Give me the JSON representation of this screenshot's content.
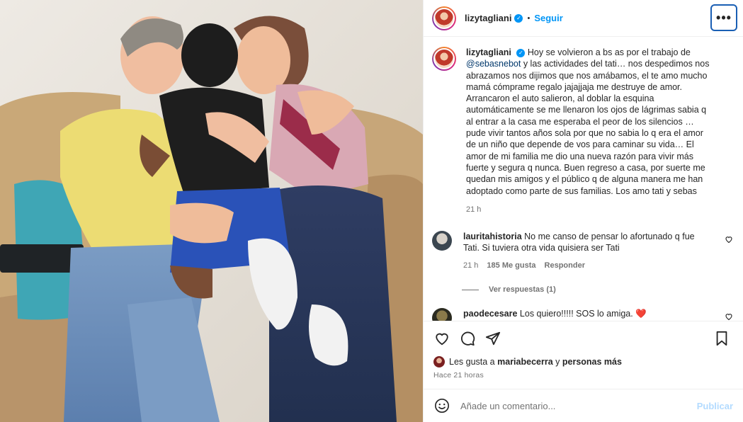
{
  "post": {
    "username": "lizytagliani",
    "follow_label": "Seguir",
    "more_label": "•••",
    "caption_mention": "@sebasnebot",
    "caption_part1": "Hoy se volvieron a bs as por el trabajo de",
    "caption_part2": "y las actividades del tati… nos despedimos nos abrazamos nos dijimos que nos amábamos, el te amo mucho mamá cómprame regalo jajajjaja me destruye de amor. Arrancaron el auto salieron, al doblar la esquina automáticamente se me llenaron los ojos de lágrimas sabia q al entrar a la casa me esperaba el peor de los silencios … pude vivir tantos años sola por que no sabia lo q era el amor de un niño que depende de vos para caminar su vida… El amor de mi familia me dio una nueva razón para vivir más fuerte y segura q nunca. Buen regreso a casa, por suerte me quedan mis amigos y el público q de alguna manera me han adoptado como parte de sus familias. Los amo tati y sebas",
    "caption_time": "21 h"
  },
  "comments": [
    {
      "username": "lauritahistoria",
      "text": "No me canso de pensar lo afortunado q fue Tati. Si tuviera otra vida quisiera ser Tati",
      "time": "21 h",
      "likes": "185 Me gusta",
      "reply_label": "Responder",
      "replies_label": "Ver respuestas (1)"
    },
    {
      "username": "paodecesare",
      "text": "Los quiero!!!!! SOS lo amiga. ❤️"
    }
  ],
  "likes": {
    "prefix": "Les gusta a",
    "user": "mariabecerra",
    "connector": "y",
    "others": "personas más"
  },
  "posted_ago": "Hace 21 horas",
  "add_comment": {
    "placeholder": "Añade un comentario...",
    "publish_label": "Publicar"
  },
  "colors": {
    "accent": "#0095f6",
    "mention": "#00376b",
    "heart": "#ed4956",
    "muted": "#737373"
  },
  "icons": [
    "verified-icon",
    "heart-icon",
    "comment-icon",
    "share-icon",
    "save-icon",
    "emoji-icon"
  ]
}
